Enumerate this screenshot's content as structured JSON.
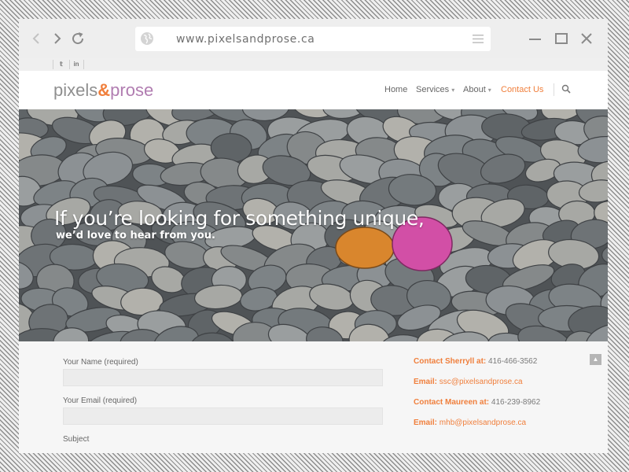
{
  "browser": {
    "url": "www.pixelsandprose.ca",
    "back_icon": "chevron-left-icon",
    "forward_icon": "chevron-right-icon",
    "reload_icon": "reload-icon",
    "globe_icon": "globe-icon",
    "menu_icon": "hamburger-menu-icon",
    "minimize_icon": "minimize-icon",
    "maximize_icon": "maximize-icon",
    "close_icon": "close-icon"
  },
  "social": {
    "twitter": "𝕥",
    "linkedin": "in"
  },
  "site": {
    "logo_part1": "pixels",
    "logo_amp": "&",
    "logo_part2": "prose",
    "accent_color": "#f07f3c",
    "brand_purple": "#b17db1",
    "nav": {
      "home": "Home",
      "services": "Services",
      "about": "About",
      "contact": "Contact Us",
      "dropdown_caret": "▾"
    }
  },
  "hero": {
    "headline": "If you’re looking for something unique,",
    "subline": "we’d love to hear from you."
  },
  "form": {
    "name_label": "Your Name (required)",
    "email_label": "Your Email (required)",
    "subject_label": "Subject",
    "name_value": "",
    "email_value": ""
  },
  "contacts": {
    "sherryll_label": "Contact Sherryll at:",
    "sherryll_phone": "416-466-3562",
    "email1_label": "Email:",
    "email1_value": "ssc@pixelsandprose.ca",
    "maureen_label": "Contact Maureen at:",
    "maureen_phone": "416-239-8962",
    "email2_label": "Email:",
    "email2_value": "mhb@pixelsandprose.ca"
  },
  "scroll_top_icon": "▲"
}
